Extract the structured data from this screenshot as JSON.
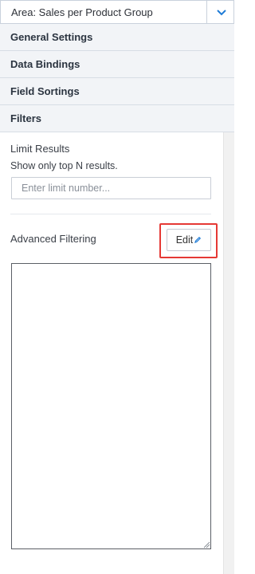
{
  "area": {
    "label": "Area: Sales per Product Group",
    "chevron_icon": "chevron-down-icon"
  },
  "sections": [
    {
      "label": "General Settings"
    },
    {
      "label": "Data Bindings"
    },
    {
      "label": "Field Sortings"
    },
    {
      "label": "Filters"
    }
  ],
  "filters": {
    "limit_title": "Limit Results",
    "limit_description": "Show only top N results.",
    "limit_placeholder": "Enter limit number...",
    "advanced_title": "Advanced Filtering",
    "edit_label": "Edit",
    "edit_icon": "pencil-icon"
  },
  "colors": {
    "accent": "#1e7bd6",
    "highlight": "#e53935",
    "section_bg": "#f2f4f7"
  }
}
